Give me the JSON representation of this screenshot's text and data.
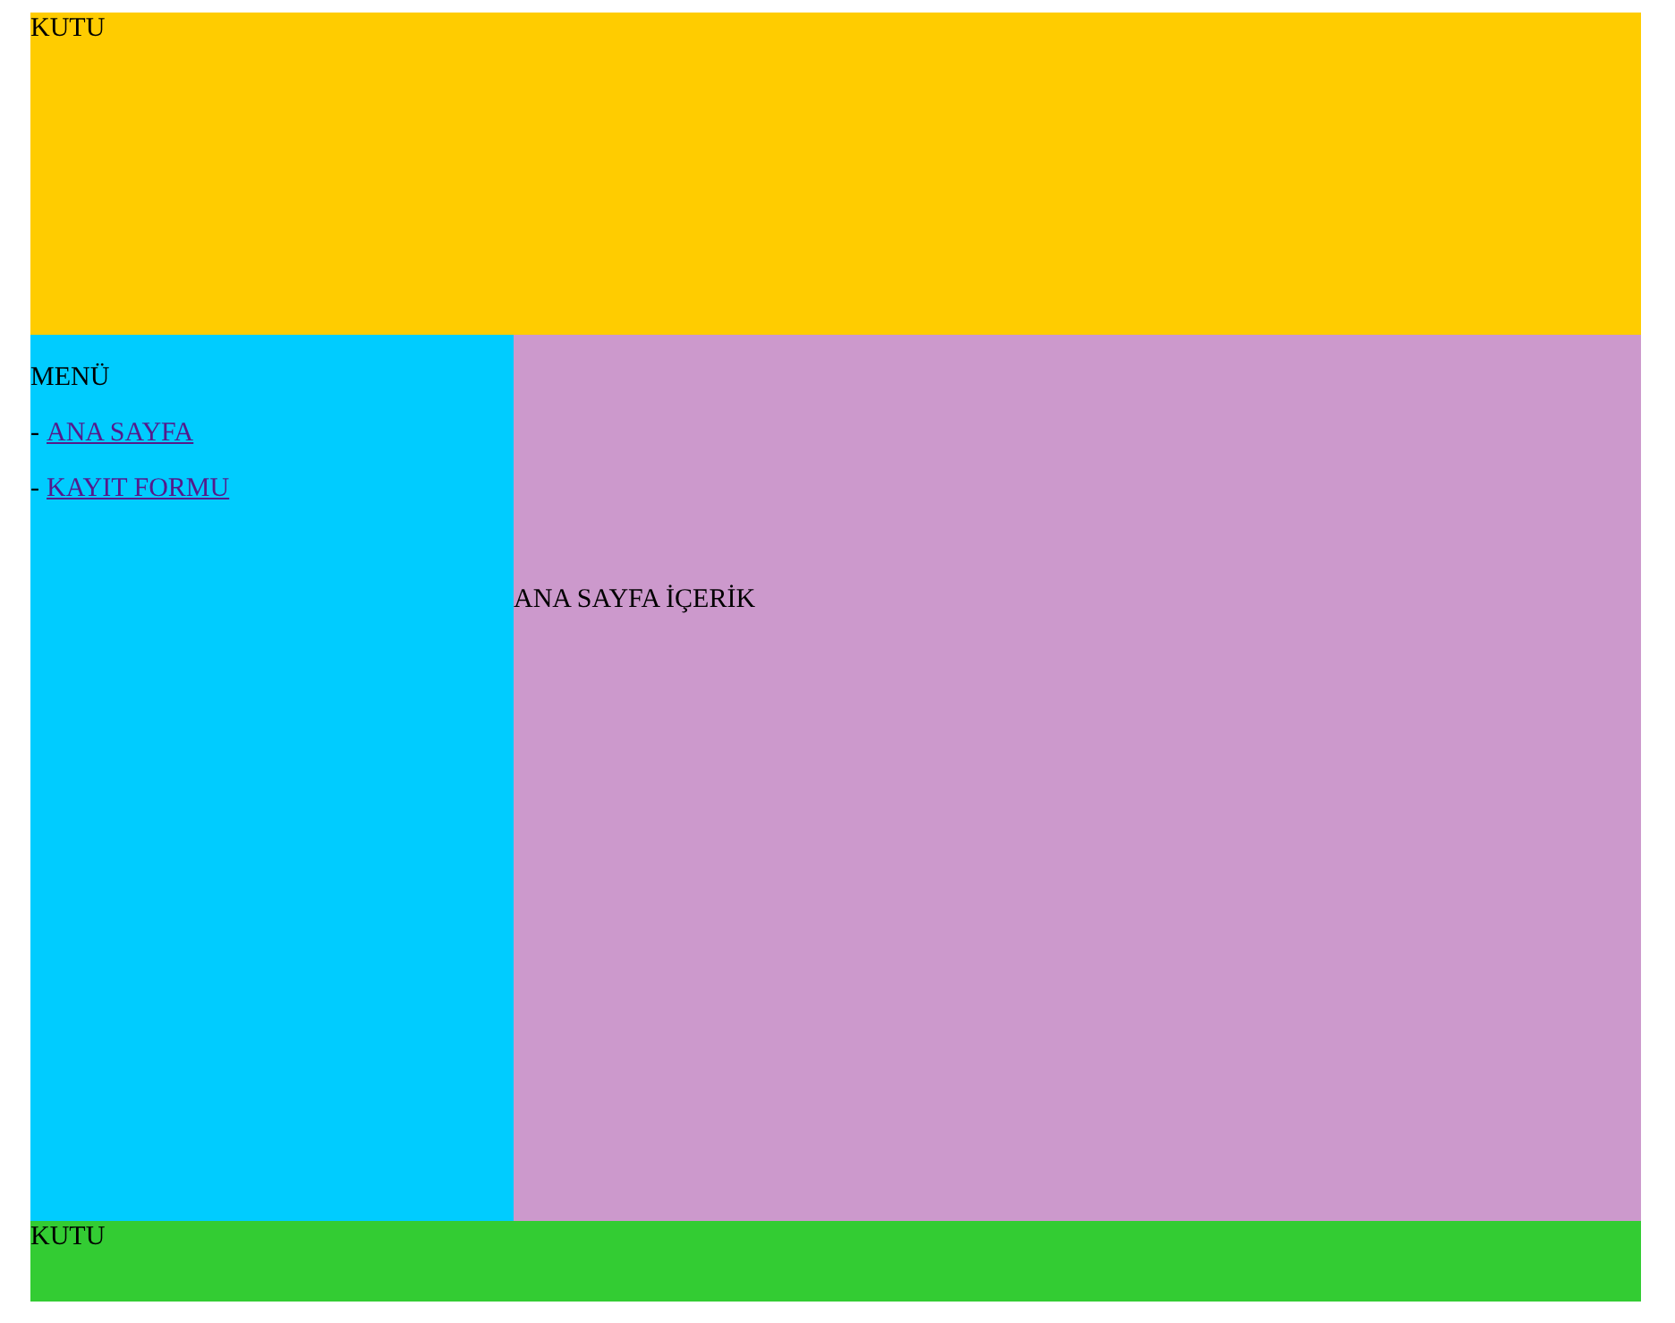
{
  "header": {
    "text": "KUTU"
  },
  "menu": {
    "title": "MENÜ",
    "items": [
      {
        "bullet": "-",
        "label": "ANA SAYFA"
      },
      {
        "bullet": "-",
        "label": "KAYIT FORMU"
      }
    ]
  },
  "content": {
    "text": "ANA SAYFA İÇERİK"
  },
  "footer": {
    "text": "KUTU"
  }
}
